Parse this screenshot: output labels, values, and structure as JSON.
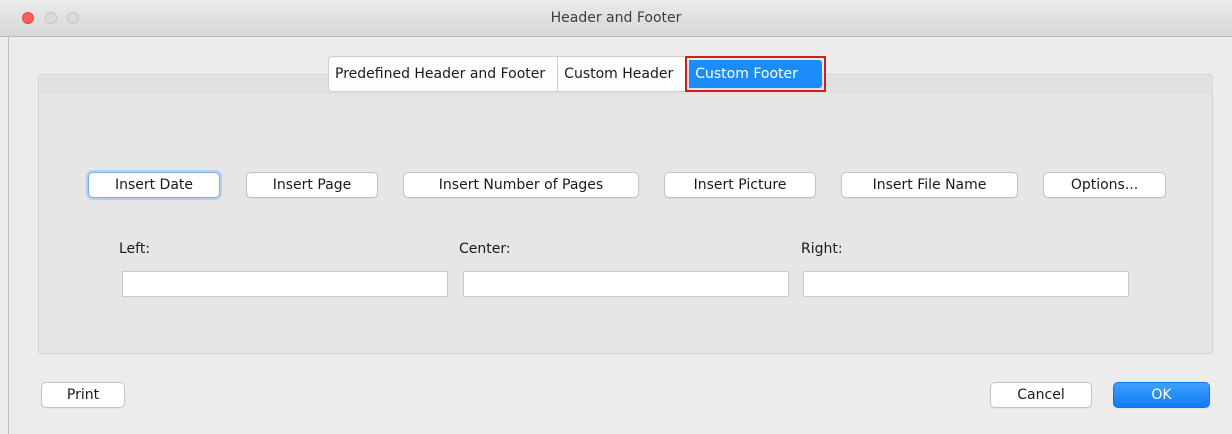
{
  "window": {
    "title": "Header and Footer"
  },
  "tabs": [
    {
      "label": "Predefined Header and Footer"
    },
    {
      "label": "Custom Header"
    },
    {
      "label": "Custom Footer",
      "selected": true
    }
  ],
  "insert_buttons": {
    "insert_date": "Insert Date",
    "insert_page": "Insert Page",
    "insert_number_of_pages": "Insert Number of Pages",
    "insert_picture": "Insert Picture",
    "insert_file_name": "Insert File Name",
    "options": "Options..."
  },
  "sections": {
    "left": {
      "label": "Left:",
      "value": ""
    },
    "center": {
      "label": "Center:",
      "value": ""
    },
    "right": {
      "label": "Right:",
      "value": ""
    }
  },
  "footer_buttons": {
    "print": "Print",
    "cancel": "Cancel",
    "ok": "OK"
  },
  "colors": {
    "selected_tab": "#1b8cf8",
    "highlight_border": "#cc1f1f",
    "primary_button": "#0f7cf5",
    "close_button": "#fc605c"
  }
}
